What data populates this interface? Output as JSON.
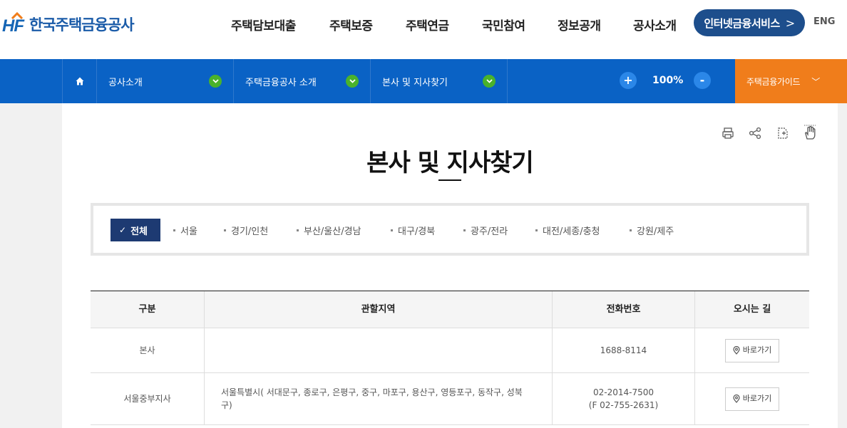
{
  "header": {
    "logo_mark": "HF",
    "logo_text": "한국주택금융공사",
    "nav": [
      "주택담보대출",
      "주택보증",
      "주택연금",
      "국민참여",
      "정보공개",
      "공사소개"
    ],
    "service_button": "인터넷금융서비스",
    "service_chevron": ">",
    "lang": "ENG"
  },
  "subnav": {
    "home_icon": "home-icon",
    "breadcrumbs": [
      "공사소개",
      "주택금융공사 소개",
      "본사 및 지사찾기"
    ],
    "zoom_in": "+",
    "zoom_value": "100%",
    "zoom_out": "-",
    "guide_label": "주택금융가이드",
    "guide_chevron": "﹀"
  },
  "colors": {
    "brand_blue": "#0a62c5",
    "navy": "#1d3a72",
    "orange": "#f07d1b",
    "green": "#4ab22c"
  },
  "tools": [
    "print-icon",
    "share-icon",
    "copy-url-icon",
    "hand-cursor-icon"
  ],
  "page_title": "본사 및 지사찾기",
  "tabs": {
    "active_check": "✓",
    "items": [
      "전체",
      "서울",
      "경기/인천",
      "부산/울산/경남",
      "대구/경북",
      "광주/전라",
      "대전/세종/충청",
      "강원/제주"
    ]
  },
  "table": {
    "headers": [
      "구분",
      "관할지역",
      "전화번호",
      "오시는 길"
    ],
    "rows": [
      {
        "division": "본사",
        "region": "",
        "phone": "1688-8114",
        "fax": "",
        "button": "바로가기"
      },
      {
        "division": "서울중부지사",
        "region": "서울특별시( 서대문구, 종로구, 은평구, 중구, 마포구, 용산구, 영등포구, 동작구, 성북구)",
        "phone": "02-2014-7500",
        "fax": "(F 02-755-2631)",
        "button": "바로가기"
      }
    ]
  }
}
